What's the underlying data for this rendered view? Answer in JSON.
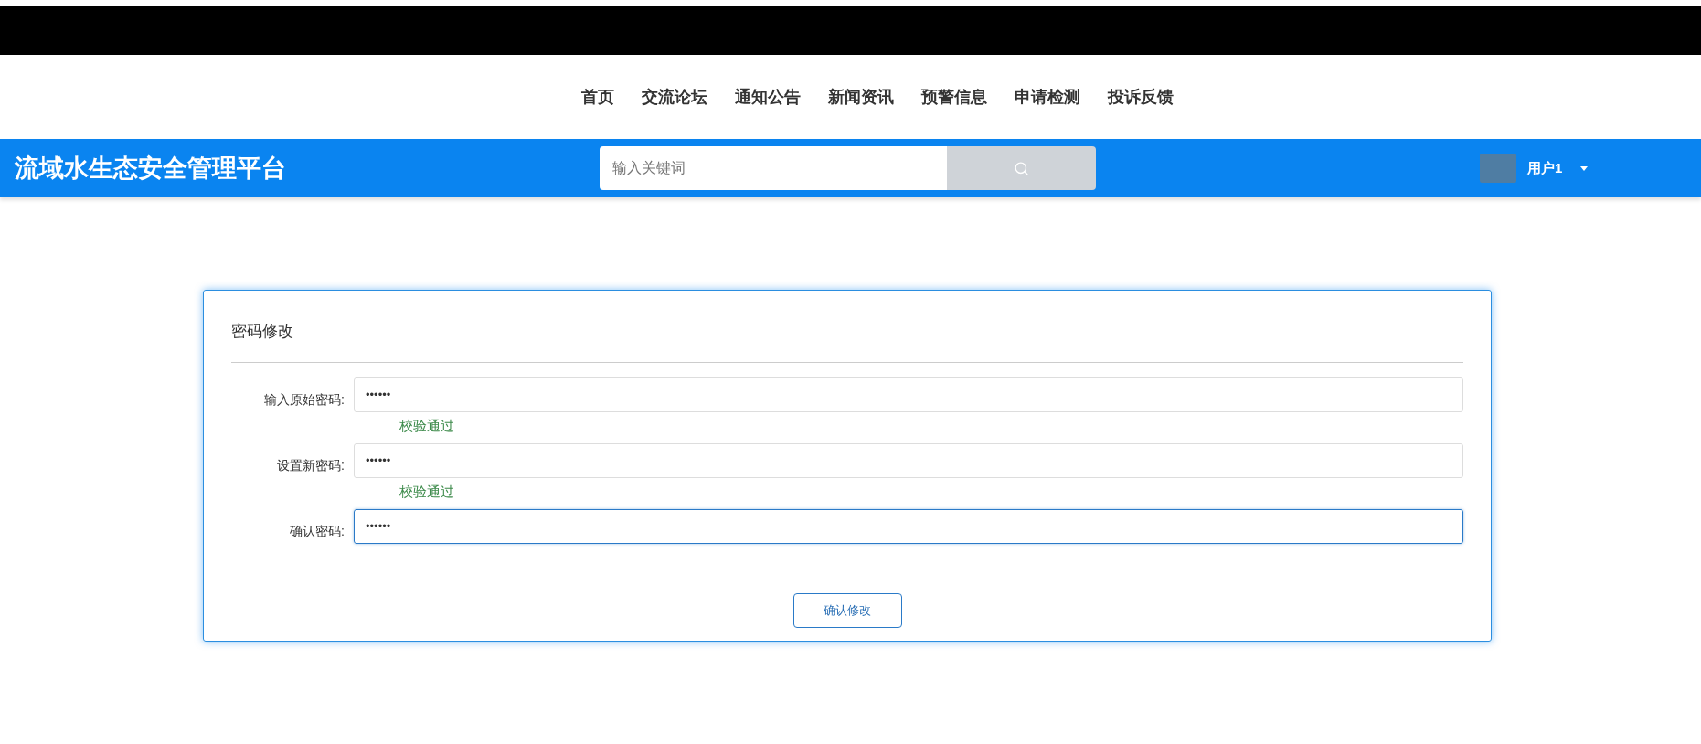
{
  "nav": [
    {
      "label": "首页"
    },
    {
      "label": "交流论坛"
    },
    {
      "label": "通知公告"
    },
    {
      "label": "新闻资讯"
    },
    {
      "label": "预警信息"
    },
    {
      "label": "申请检测"
    },
    {
      "label": "投诉反馈"
    }
  ],
  "header": {
    "title": "流域水生态安全管理平台",
    "search": {
      "placeholder": "输入关键词"
    },
    "user": {
      "name": "用户1"
    }
  },
  "form": {
    "title": "密码修改",
    "fields": [
      {
        "label": "输入原始密码:",
        "value": "••••••",
        "focused": false,
        "message": "校验通过"
      },
      {
        "label": "设置新密码:",
        "value": "••••••",
        "focused": false,
        "message": "校验通过"
      },
      {
        "label": "确认密码:",
        "value": "••••••",
        "focused": true
      }
    ],
    "submit": "确认修改"
  }
}
